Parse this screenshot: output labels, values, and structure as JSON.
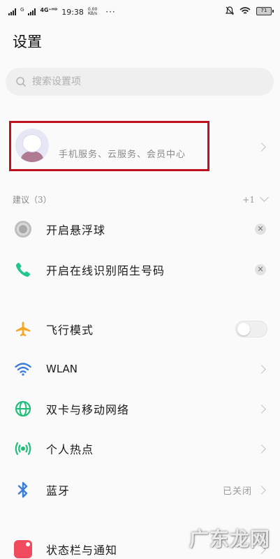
{
  "status_bar": {
    "network_small": "G",
    "network_type": "4G⁺ᴴᴰ",
    "time": "19:38",
    "speed_value": "0.00",
    "speed_unit": "KB/s",
    "more": "···",
    "battery_level": "71"
  },
  "page": {
    "title": "设置"
  },
  "search": {
    "placeholder": "搜索设置项"
  },
  "account": {
    "subtitle": "手机服务、云服务、会员中心",
    "highlight_color": "#c00f1d"
  },
  "suggestions": {
    "header": "建议（3）",
    "more_count": "+1",
    "items": [
      {
        "label": "开启悬浮球",
        "icon": "floating-ball-icon"
      },
      {
        "label": "开启在线识别陌生号码",
        "icon": "phone-icon",
        "icon_color": "#22c78b"
      }
    ]
  },
  "settings": [
    {
      "label": "飞行模式",
      "icon": "airplane-icon",
      "icon_color": "#f5a623",
      "control": "toggle",
      "toggle_on": false
    },
    {
      "label": "WLAN",
      "icon": "wifi-icon",
      "icon_color": "#3b7ddd",
      "control": "chevron"
    },
    {
      "label": "双卡与移动网络",
      "icon": "globe-icon",
      "icon_color": "#1fbf7a",
      "control": "chevron"
    },
    {
      "label": "个人热点",
      "icon": "hotspot-icon",
      "icon_color": "#1fbf7a",
      "control": "chevron"
    },
    {
      "label": "蓝牙",
      "icon": "bluetooth-icon",
      "icon_color": "#3b7ddd",
      "control": "chevron",
      "value": "已关闭"
    },
    {
      "label": "状态栏与通知",
      "icon": "notification-icon",
      "icon_color": "#f04a5e",
      "control": "chevron"
    }
  ],
  "watermark": {
    "text": "广东龙网"
  }
}
